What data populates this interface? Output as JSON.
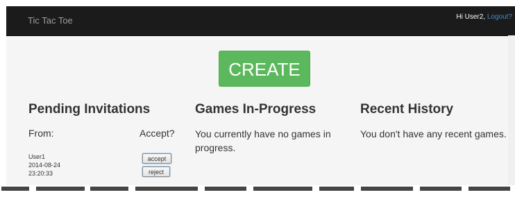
{
  "navbar": {
    "brand": "Tic Tac Toe",
    "greeting": "Hi User2,",
    "logout_label": "Logout?"
  },
  "create_label": "CREATE",
  "pending": {
    "title": "Pending Invitations",
    "from_header": "From:",
    "accept_header": "Accept?",
    "invitations": [
      {
        "user": "User1",
        "date": "2014-08-24",
        "time": "23:20:33",
        "accept_label": "accept",
        "reject_label": "reject"
      }
    ]
  },
  "in_progress": {
    "title": "Games In-Progress",
    "message": "You currently have no games in progress."
  },
  "history": {
    "title": "Recent History",
    "message": "You don't have any recent games."
  }
}
